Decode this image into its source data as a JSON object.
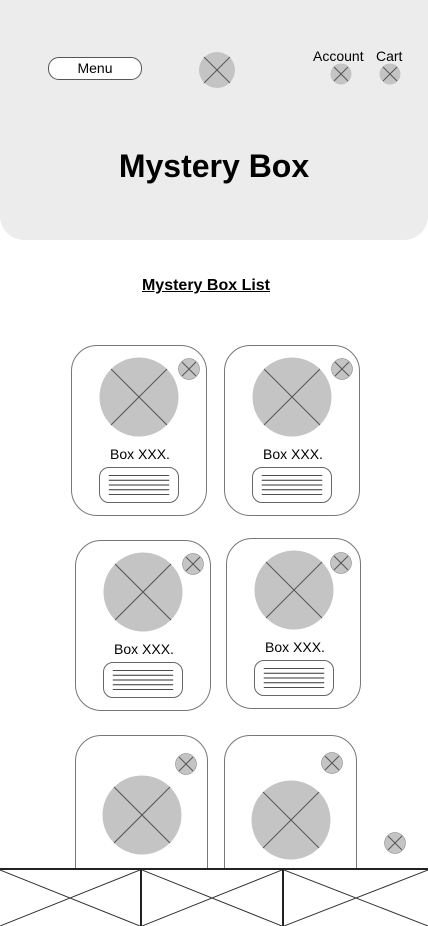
{
  "header": {
    "menu_label": "Menu",
    "account_label": "Account",
    "cart_label": "Cart",
    "title": "Mystery Box"
  },
  "main": {
    "section_title": "Mystery Box List",
    "cards": [
      {
        "label": "Box XXX."
      },
      {
        "label": "Box XXX."
      },
      {
        "label": "Box XXX."
      },
      {
        "label": "Box XXX."
      },
      {
        "label": ""
      },
      {
        "label": ""
      }
    ]
  },
  "colors": {
    "header_bg": "#ececec",
    "placeholder_fill": "#c4c4c4",
    "border": "#777777"
  }
}
